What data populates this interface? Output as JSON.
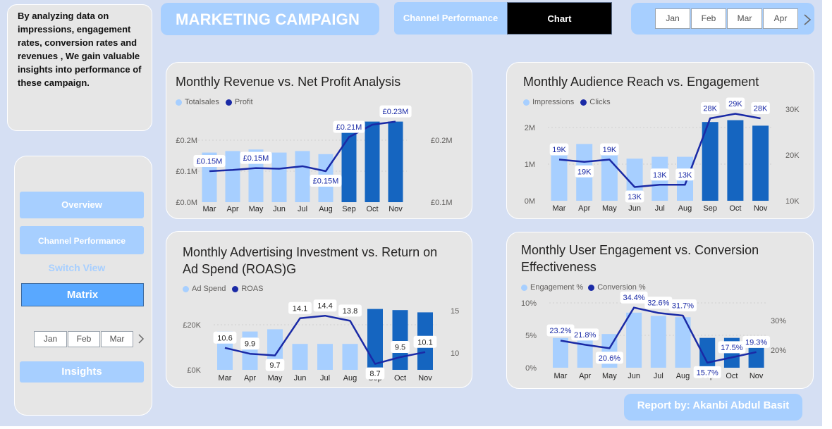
{
  "intro": {
    "text": "By analyzing data on impressions, engagement rates, conversion rates and revenues , We gain valuable insights into performance of these campaign."
  },
  "header": {
    "title": "MARKETING CAMPAIGN",
    "tabs": [
      {
        "label": "Channel Performance",
        "active": false
      },
      {
        "label": "Chart",
        "active": true
      }
    ]
  },
  "month_slicer": {
    "months": [
      "Jan",
      "Feb",
      "Mar",
      "Apr"
    ],
    "next_icon": "chevron-right-icon"
  },
  "sidebar": {
    "overview_label": "Overview",
    "channel_label": "Channel Performance",
    "switch_label": "Switch View",
    "matrix_label": "Matrix",
    "months": [
      "Jan",
      "Feb",
      "Mar"
    ],
    "next_icon": "chevron-right-icon",
    "insights_label": "Insights"
  },
  "footer": {
    "report_label": "Report by: Akanbi Abdul Basit"
  },
  "colors": {
    "light_bar": "#a7cfff",
    "dark_bar": "#1565c0",
    "line": "#1a2aa6",
    "background": "#d5dff3",
    "card": "#e6e6e6"
  },
  "cards": {
    "revenue": {
      "title": "Monthly Revenue vs. Net Profit Analysis",
      "legend": [
        "Totalsales",
        "Profit"
      ]
    },
    "audience": {
      "title": "Monthly Audience Reach vs. Engagement",
      "legend": [
        "Impressions",
        "Clicks"
      ]
    },
    "adspend": {
      "title_line1": "Monthly Advertising Investment vs. Return on",
      "title_line2": "Ad Spend (ROAS)G",
      "legend": [
        "Ad Spend",
        "ROAS"
      ]
    },
    "engagement": {
      "title_line1": "Monthly User Engagement vs. Conversion",
      "title_line2": "Effectiveness",
      "legend": [
        "Engagement %",
        "Conversion %"
      ]
    }
  },
  "chart_data": [
    {
      "type": "bar",
      "categories": [
        "Mar",
        "Apr",
        "May",
        "Jun",
        "Jul",
        "Aug",
        "Sep",
        "Oct",
        "Nov"
      ],
      "series": [
        {
          "name": "Totalsales",
          "values": [
            0.16,
            0.165,
            0.17,
            0.16,
            0.165,
            0.155,
            0.245,
            0.26,
            0.26
          ],
          "highlighted": [
            false,
            false,
            false,
            false,
            false,
            false,
            true,
            true,
            true
          ]
        },
        {
          "name": "Profit",
          "values": [
            0.15,
            0.152,
            0.155,
            0.154,
            0.158,
            0.15,
            0.205,
            0.225,
            0.23
          ]
        }
      ],
      "data_labels": [
        {
          "series": "Profit",
          "index": 0,
          "text": "£0.15M"
        },
        {
          "series": "Profit",
          "index": 2,
          "text": "£0.15M"
        },
        {
          "series": "Profit",
          "index": 5,
          "text": "£0.15M"
        },
        {
          "series": "Profit",
          "index": 6,
          "text": "£0.21M"
        },
        {
          "series": "Profit",
          "index": 8,
          "text": "£0.23M"
        }
      ],
      "y_ticks": [
        "£0.0M",
        "£0.1M",
        "£0.2M"
      ],
      "y2_ticks": [
        "£0.1M",
        "£0.2M"
      ],
      "ylim": [
        0,
        0.3
      ],
      "y2lim": [
        0.1,
        0.25
      ]
    },
    {
      "type": "bar",
      "categories": [
        "Mar",
        "Apr",
        "May",
        "Jun",
        "Jul",
        "Aug",
        "Sep",
        "Oct",
        "Nov"
      ],
      "series": [
        {
          "name": "Impressions",
          "values": [
            1500000,
            1550000,
            1500000,
            1150000,
            1200000,
            1200000,
            2150000,
            2200000,
            2050000
          ],
          "highlighted": [
            false,
            false,
            false,
            false,
            false,
            false,
            true,
            true,
            true
          ]
        },
        {
          "name": "Clicks",
          "values": [
            19000,
            18500,
            19000,
            13000,
            13500,
            13500,
            28000,
            29000,
            28000
          ]
        }
      ],
      "data_labels": [
        {
          "series": "Clicks",
          "index": 0,
          "text": "19K"
        },
        {
          "series": "Clicks",
          "index": 1,
          "text": "19K"
        },
        {
          "series": "Clicks",
          "index": 2,
          "text": "19K"
        },
        {
          "series": "Clicks",
          "index": 3,
          "text": "13K"
        },
        {
          "series": "Clicks",
          "index": 4,
          "text": "13K"
        },
        {
          "series": "Clicks",
          "index": 5,
          "text": "13K"
        },
        {
          "series": "Clicks",
          "index": 6,
          "text": "28K"
        },
        {
          "series": "Clicks",
          "index": 7,
          "text": "29K"
        },
        {
          "series": "Clicks",
          "index": 8,
          "text": "28K"
        }
      ],
      "y_ticks": [
        "0M",
        "1M",
        "2M"
      ],
      "y2_ticks": [
        "10K",
        "20K",
        "30K"
      ],
      "ylim": [
        0,
        2500000
      ],
      "y2lim": [
        10000,
        30000
      ]
    },
    {
      "type": "bar",
      "categories": [
        "Mar",
        "Apr",
        "May",
        "Jun",
        "Jul",
        "Aug",
        "Sep",
        "Oct",
        "Nov"
      ],
      "series": [
        {
          "name": "Ad Spend",
          "values": [
            17000,
            17000,
            18000,
            11500,
            11500,
            11500,
            27000,
            26500,
            25500
          ],
          "highlighted": [
            false,
            false,
            false,
            false,
            false,
            false,
            true,
            true,
            true
          ]
        },
        {
          "name": "ROAS",
          "values": [
            10.6,
            9.9,
            9.7,
            14.1,
            14.4,
            13.8,
            8.7,
            9.5,
            10.1
          ]
        }
      ],
      "data_labels": [
        {
          "series": "ROAS",
          "index": 0,
          "text": "10.6"
        },
        {
          "series": "ROAS",
          "index": 1,
          "text": "9.9"
        },
        {
          "series": "ROAS",
          "index": 2,
          "text": "9.7"
        },
        {
          "series": "ROAS",
          "index": 3,
          "text": "14.1"
        },
        {
          "series": "ROAS",
          "index": 4,
          "text": "14.4"
        },
        {
          "series": "ROAS",
          "index": 5,
          "text": "13.8"
        },
        {
          "series": "ROAS",
          "index": 6,
          "text": "8.7"
        },
        {
          "series": "ROAS",
          "index": 7,
          "text": "9.5"
        },
        {
          "series": "ROAS",
          "index": 8,
          "text": "10.1"
        }
      ],
      "y_ticks": [
        "£0K",
        "£20K"
      ],
      "y2_ticks": [
        "10",
        "15"
      ],
      "ylim": [
        0,
        30000
      ],
      "y2lim": [
        8,
        16
      ]
    },
    {
      "type": "bar",
      "categories": [
        "Mar",
        "Apr",
        "May",
        "Jun",
        "Jul",
        "Aug",
        "Sep",
        "Oct",
        "Nov"
      ],
      "series": [
        {
          "name": "Engagement %",
          "values": [
            4.6,
            5.0,
            5.2,
            8.5,
            8.0,
            7.8,
            4.6,
            4.6,
            4.5
          ],
          "highlighted": [
            false,
            false,
            false,
            false,
            false,
            false,
            true,
            true,
            true
          ]
        },
        {
          "name": "Conversion %",
          "values": [
            23.2,
            21.8,
            20.6,
            34.4,
            32.6,
            31.7,
            15.7,
            17.5,
            19.3
          ]
        }
      ],
      "data_labels": [
        {
          "series": "Conversion %",
          "index": 0,
          "text": "23.2%"
        },
        {
          "series": "Conversion %",
          "index": 1,
          "text": "21.8%"
        },
        {
          "series": "Conversion %",
          "index": 2,
          "text": "20.6%"
        },
        {
          "series": "Conversion %",
          "index": 3,
          "text": "34.4%"
        },
        {
          "series": "Conversion %",
          "index": 4,
          "text": "32.6%"
        },
        {
          "series": "Conversion %",
          "index": 5,
          "text": "31.7%"
        },
        {
          "series": "Conversion %",
          "index": 6,
          "text": "15.7%"
        },
        {
          "series": "Conversion %",
          "index": 7,
          "text": "17.5%"
        },
        {
          "series": "Conversion %",
          "index": 8,
          "text": "19.3%"
        }
      ],
      "y_ticks": [
        "0%",
        "5%",
        "10%"
      ],
      "y2_ticks": [
        "20%",
        "30%"
      ],
      "ylim": [
        0,
        10
      ],
      "y2lim": [
        14,
        36
      ]
    }
  ]
}
